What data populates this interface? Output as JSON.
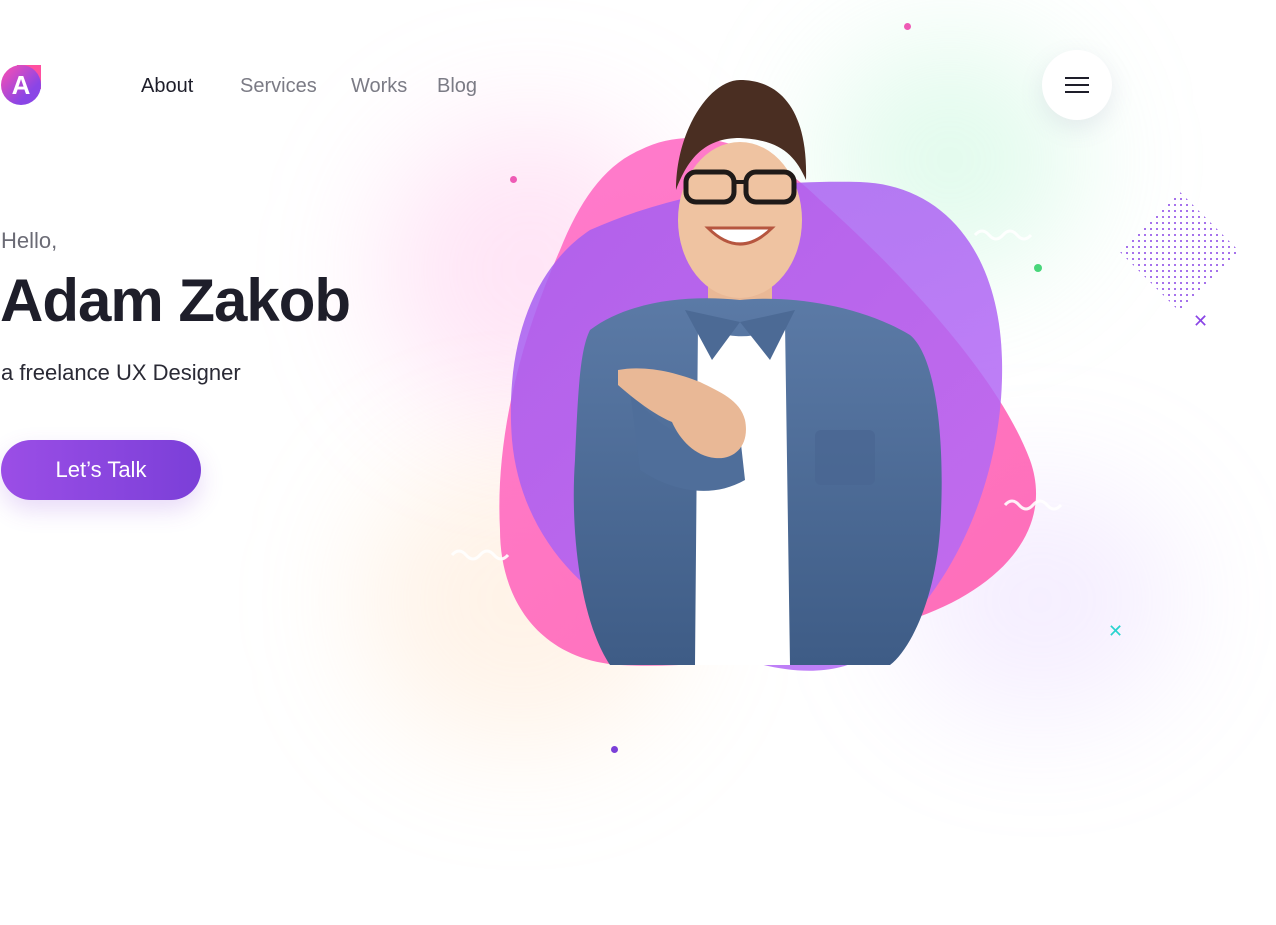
{
  "brand": {
    "logo_letter": "A",
    "colors": {
      "primary": "#8a45e6",
      "accent_pink": "#ff4fa0",
      "text_dark": "#1e1e2a",
      "text_muted": "#7b7b85"
    }
  },
  "nav": {
    "items": [
      {
        "label": "About",
        "active": true
      },
      {
        "label": "Services",
        "active": false
      },
      {
        "label": "Works",
        "active": false
      },
      {
        "label": "Blog",
        "active": false
      }
    ]
  },
  "menu_button": {
    "icon": "hamburger-icon"
  },
  "hero": {
    "greeting": "Hello,",
    "name": "Adam Zakob",
    "role": "a freelance UX Designer",
    "cta_label": "Let’s Talk",
    "image": "portrait-man-pointing"
  },
  "decorations": {
    "icons": [
      "dot-pattern-diamond",
      "cross-icon",
      "squiggle-icon",
      "dot-icon"
    ]
  }
}
